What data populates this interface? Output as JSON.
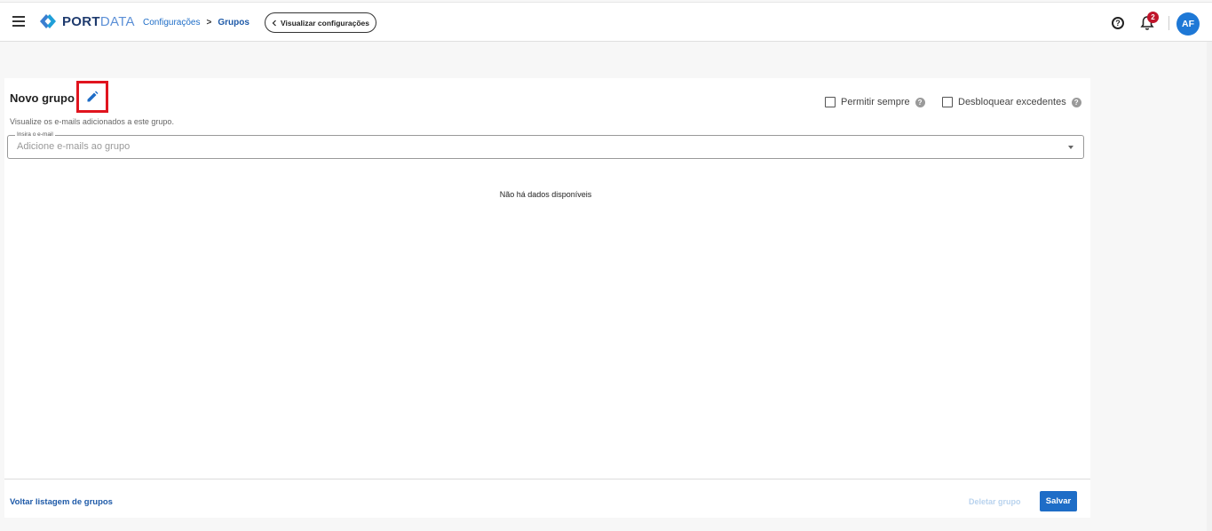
{
  "header": {
    "logo_port": "PORT",
    "logo_data": "DATA",
    "breadcrumb": [
      "Configurações",
      ">",
      "Grupos"
    ],
    "view_button_label": "Visualizar configurações",
    "notification_count": "2",
    "avatar_initials": "AF",
    "help_glyph": "?"
  },
  "group": {
    "title": "Novo grupo",
    "subtitle": "Visualize os e-mails adicionados a este grupo.",
    "options": [
      {
        "label": "Permitir sempre",
        "checked": false,
        "help": "?"
      },
      {
        "label": "Desbloquear excedentes",
        "checked": false,
        "help": "?"
      }
    ]
  },
  "email_field": {
    "legend": "Insira o e-mail",
    "placeholder": "Adicione e-mails ao grupo",
    "value": ""
  },
  "empty_message": "Não há dados disponíveis",
  "footer": {
    "back_label": "Voltar listagem de grupos",
    "delete_label": "Deletar grupo",
    "save_label": "Salvar"
  },
  "icons": {
    "menu": "menu-icon",
    "edit": "pencil-icon",
    "help": "help-circle-icon",
    "bell": "bell-icon",
    "chevron": "chevron-left-icon",
    "caret": "caret-down-icon"
  },
  "colors": {
    "primary": "#1e6dc7",
    "highlight_box": "#e0141e",
    "badge": "#c0142a",
    "avatar": "#1e78d6"
  }
}
